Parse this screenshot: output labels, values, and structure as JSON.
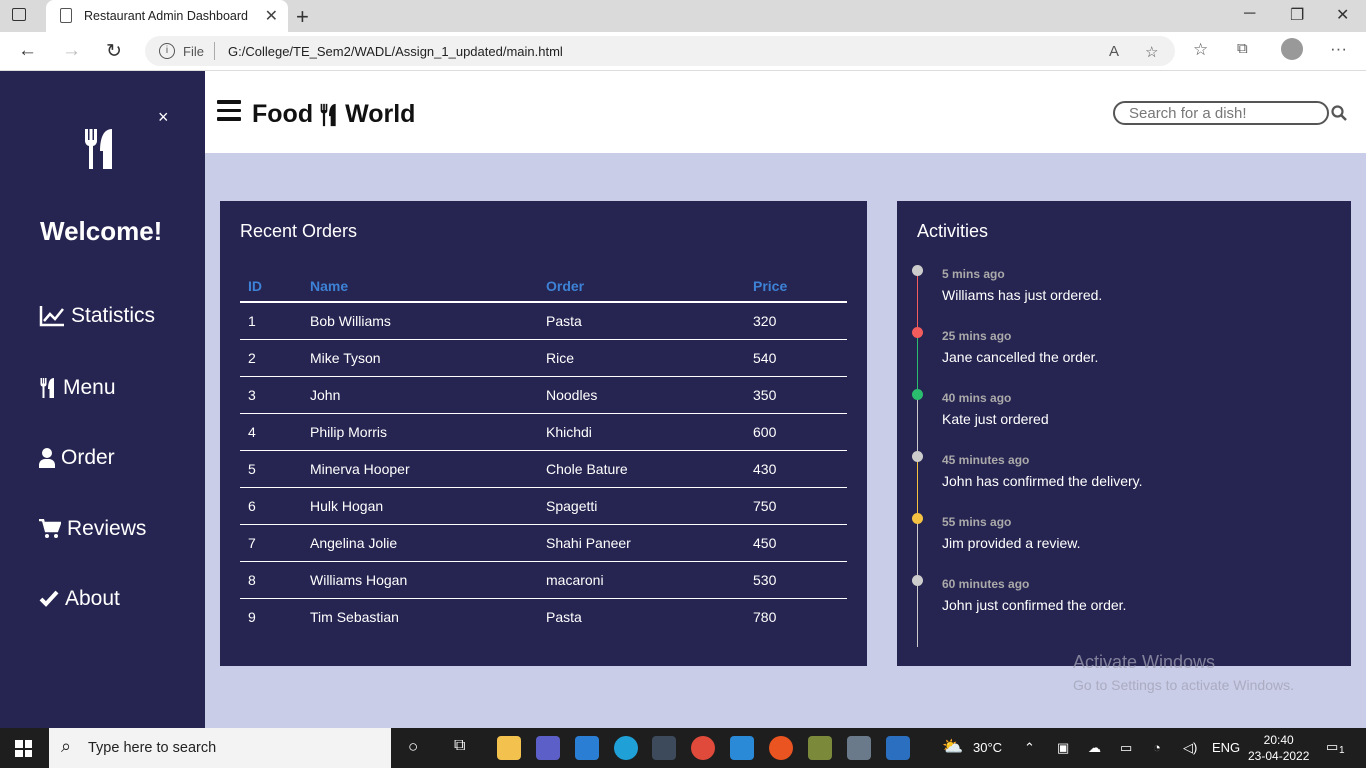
{
  "browser": {
    "tab_title": "Restaurant Admin Dashboard",
    "url_scheme_label": "File",
    "url": "G:/College/TE_Sem2/WADL/Assign_1_updated/main.html"
  },
  "sidebar": {
    "welcome": "Welcome!",
    "close_symbol": "×",
    "items": [
      {
        "label": "Statistics",
        "icon": "chart-line-icon"
      },
      {
        "label": "Menu",
        "icon": "utensils-icon"
      },
      {
        "label": "Order",
        "icon": "user-icon"
      },
      {
        "label": "Reviews",
        "icon": "cart-icon"
      },
      {
        "label": "About",
        "icon": "check-icon"
      }
    ]
  },
  "header": {
    "brand_left": "Food",
    "brand_right": "World",
    "search_placeholder": "Search for a dish!"
  },
  "orders": {
    "title": "Recent Orders",
    "columns": [
      "ID",
      "Name",
      "Order",
      "Price"
    ],
    "rows": [
      [
        "1",
        "Bob Williams",
        "Pasta",
        "320"
      ],
      [
        "2",
        "Mike Tyson",
        "Rice",
        "540"
      ],
      [
        "3",
        "John",
        "Noodles",
        "350"
      ],
      [
        "4",
        "Philip Morris",
        "Khichdi",
        "600"
      ],
      [
        "5",
        "Minerva Hooper",
        "Chole Bature",
        "430"
      ],
      [
        "6",
        "Hulk Hogan",
        "Spagetti",
        "750"
      ],
      [
        "7",
        "Angelina Jolie",
        "Shahi Paneer",
        "450"
      ],
      [
        "8",
        "Williams Hogan",
        "macaroni",
        "530"
      ],
      [
        "9",
        "Tim Sebastian",
        "Pasta",
        "780"
      ]
    ]
  },
  "activities": {
    "title": "Activities",
    "items": [
      {
        "time": "5 mins ago",
        "text": "Williams has just ordered.",
        "color": "#cccccc"
      },
      {
        "time": "25 mins ago",
        "text": "Jane cancelled the order.",
        "color": "#f25c5c"
      },
      {
        "time": "40 mins ago",
        "text": "Kate just ordered",
        "color": "#2bbd6e"
      },
      {
        "time": "45 minutes ago",
        "text": "John has confirmed the delivery.",
        "color": "#cccccc"
      },
      {
        "time": "55 mins ago",
        "text": "Jim provided a review.",
        "color": "#f5c242"
      },
      {
        "time": "60 minutes ago",
        "text": "John just confirmed the order.",
        "color": "#cccccc"
      }
    ]
  },
  "watermark": {
    "line1": "Activate Windows",
    "line2": "Go to Settings to activate Windows."
  },
  "taskbar": {
    "search_placeholder": "Type here to search",
    "weather": "30°C",
    "language": "ENG",
    "time": "20:40",
    "date": "23-04-2022",
    "notification_count": "1"
  },
  "colors": {
    "sidebar_bg": "#262450",
    "page_bg": "#c9cde8",
    "table_header": "#3d82d6"
  }
}
